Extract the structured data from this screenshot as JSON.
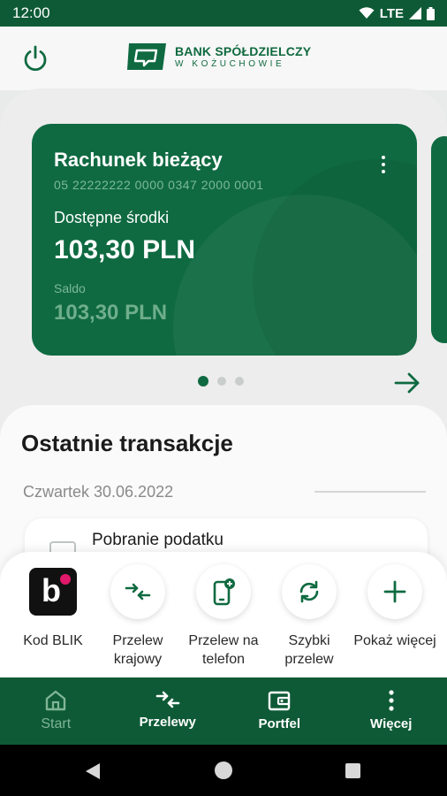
{
  "status_bar": {
    "time": "12:00",
    "network": "LTE"
  },
  "header": {
    "bank_name_line1": "BANK SPÓŁDZIELCZY",
    "bank_name_line2": "W KOŻUCHOWIE"
  },
  "account_card": {
    "title": "Rachunek bieżący",
    "number": "05 22222222 0000 0347 2000 0001",
    "available_label": "Dostępne środki",
    "available_value": "103,30 PLN",
    "saldo_label": "Saldo",
    "saldo_value": "103,30 PLN",
    "page_count": 3,
    "active_page": 1
  },
  "transactions": {
    "title": "Ostatnie transakcje",
    "date_header": "Czwartek 30.06.2022",
    "items": [
      {
        "name": "Pobranie podatku"
      }
    ]
  },
  "quick_actions": [
    {
      "label": "Kod BLIK",
      "icon": "blik-icon"
    },
    {
      "label": "Przelew krajowy",
      "icon": "transfer-arrows-icon"
    },
    {
      "label": "Przelew na telefon",
      "icon": "phone-transfer-icon"
    },
    {
      "label": "Szybki przelew",
      "icon": "refresh-icon"
    },
    {
      "label": "Pokaż więcej",
      "icon": "plus-icon"
    }
  ],
  "bottom_nav": [
    {
      "label": "Start",
      "icon": "home-icon",
      "active": true
    },
    {
      "label": "Przelewy",
      "icon": "transfer-arrows-icon",
      "active": false
    },
    {
      "label": "Portfel",
      "icon": "wallet-icon",
      "active": false
    },
    {
      "label": "Więcej",
      "icon": "more-vertical-icon",
      "active": false
    }
  ],
  "colors": {
    "brand_green": "#0f6a41",
    "dark_green": "#0e5a36",
    "inactive_nav_text": "#7fb596",
    "blik_pink": "#e0196a"
  }
}
